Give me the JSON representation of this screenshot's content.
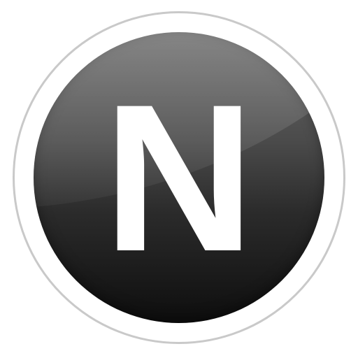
{
  "icon": {
    "letter": "N",
    "name": "n-logo-icon"
  },
  "colors": {
    "ring": "#c9c9c9",
    "disc_top": "#6b6b6b",
    "disc_bottom": "#0e0e0e",
    "letter": "#ffffff",
    "background": "#ffffff"
  }
}
